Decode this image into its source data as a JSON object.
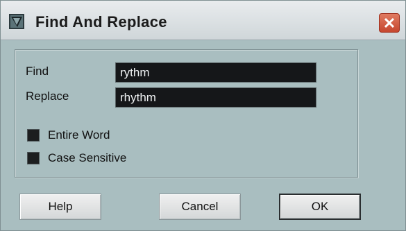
{
  "window": {
    "title": "Find And Replace",
    "close_symbol": "✕"
  },
  "form": {
    "find_label": "Find",
    "find_value": "rythm",
    "replace_label": "Replace",
    "replace_value": "rhythm",
    "entire_word_label": "Entire Word",
    "case_sensitive_label": "Case Sensitive"
  },
  "buttons": {
    "help": "Help",
    "cancel": "Cancel",
    "ok": "OK"
  },
  "icons": {
    "title_icon": "app-icon",
    "close_icon": "close-icon"
  },
  "colors": {
    "dialog_background": "#a9bec0",
    "field_background": "#151719",
    "close_button": "#c6462e"
  }
}
